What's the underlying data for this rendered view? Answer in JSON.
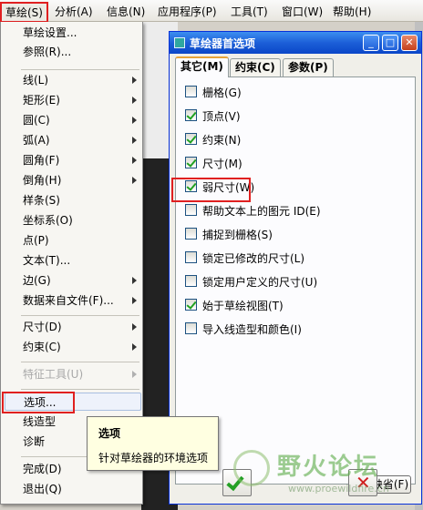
{
  "menubar": {
    "items": [
      "草绘(S)",
      "分析(A)",
      "信息(N)",
      "应用程序(P)",
      "工具(T)",
      "窗口(W)",
      "帮助(H)"
    ]
  },
  "menu": {
    "items": [
      {
        "label": "草绘设置...",
        "submenu": false
      },
      {
        "label": "参照(R)...",
        "submenu": false
      },
      {
        "label": "线(L)",
        "submenu": true
      },
      {
        "label": "矩形(E)",
        "submenu": true
      },
      {
        "label": "圆(C)",
        "submenu": true
      },
      {
        "label": "弧(A)",
        "submenu": true
      },
      {
        "label": "圆角(F)",
        "submenu": true
      },
      {
        "label": "倒角(H)",
        "submenu": true
      },
      {
        "label": "样条(S)",
        "submenu": false
      },
      {
        "label": "坐标系(O)",
        "submenu": false
      },
      {
        "label": "点(P)",
        "submenu": false
      },
      {
        "label": "文本(T)...",
        "submenu": false
      },
      {
        "label": "边(G)",
        "submenu": true
      },
      {
        "label": "数据来自文件(F)...",
        "submenu": true
      },
      {
        "label": "尺寸(D)",
        "submenu": true
      },
      {
        "label": "约束(C)",
        "submenu": true
      },
      {
        "label": "特征工具(U)",
        "submenu": true,
        "disabled": true
      },
      {
        "label": "选项...",
        "submenu": false
      },
      {
        "label": "线造型",
        "submenu": false
      },
      {
        "label": "诊断",
        "submenu": false
      },
      {
        "label": "完成(D)",
        "submenu": false
      },
      {
        "label": "退出(Q)",
        "submenu": false
      }
    ]
  },
  "dialog": {
    "title": "草绘器首选项",
    "min": "_",
    "max": "□",
    "close": "✕",
    "tabs": [
      "其它(M)",
      "约束(C)",
      "参数(P)"
    ],
    "options": [
      {
        "label": "栅格(G)",
        "checked": false
      },
      {
        "label": "顶点(V)",
        "checked": true
      },
      {
        "label": "约束(N)",
        "checked": true
      },
      {
        "label": "尺寸(M)",
        "checked": true
      },
      {
        "label": "弱尺寸(W)",
        "checked": true
      },
      {
        "label": "帮助文本上的图元 ID(E)",
        "checked": false
      },
      {
        "label": "捕捉到栅格(S)",
        "checked": false
      },
      {
        "label": "锁定已修改的尺寸(L)",
        "checked": false
      },
      {
        "label": "锁定用户定义的尺寸(U)",
        "checked": false
      },
      {
        "label": "始于草绘视图(T)",
        "checked": true
      },
      {
        "label": "导入线造型和颜色(I)",
        "checked": false
      }
    ],
    "default_button": "缺省(F)"
  },
  "tooltip": {
    "title": "选项",
    "body": "针对草绘器的环境选项"
  },
  "watermark": {
    "text": "野火论坛",
    "url": "www.proewildfire.cn"
  },
  "colors": {
    "highlight_border": "#e02020",
    "titlebar": "#1c5fd8",
    "check": "#21a121"
  }
}
